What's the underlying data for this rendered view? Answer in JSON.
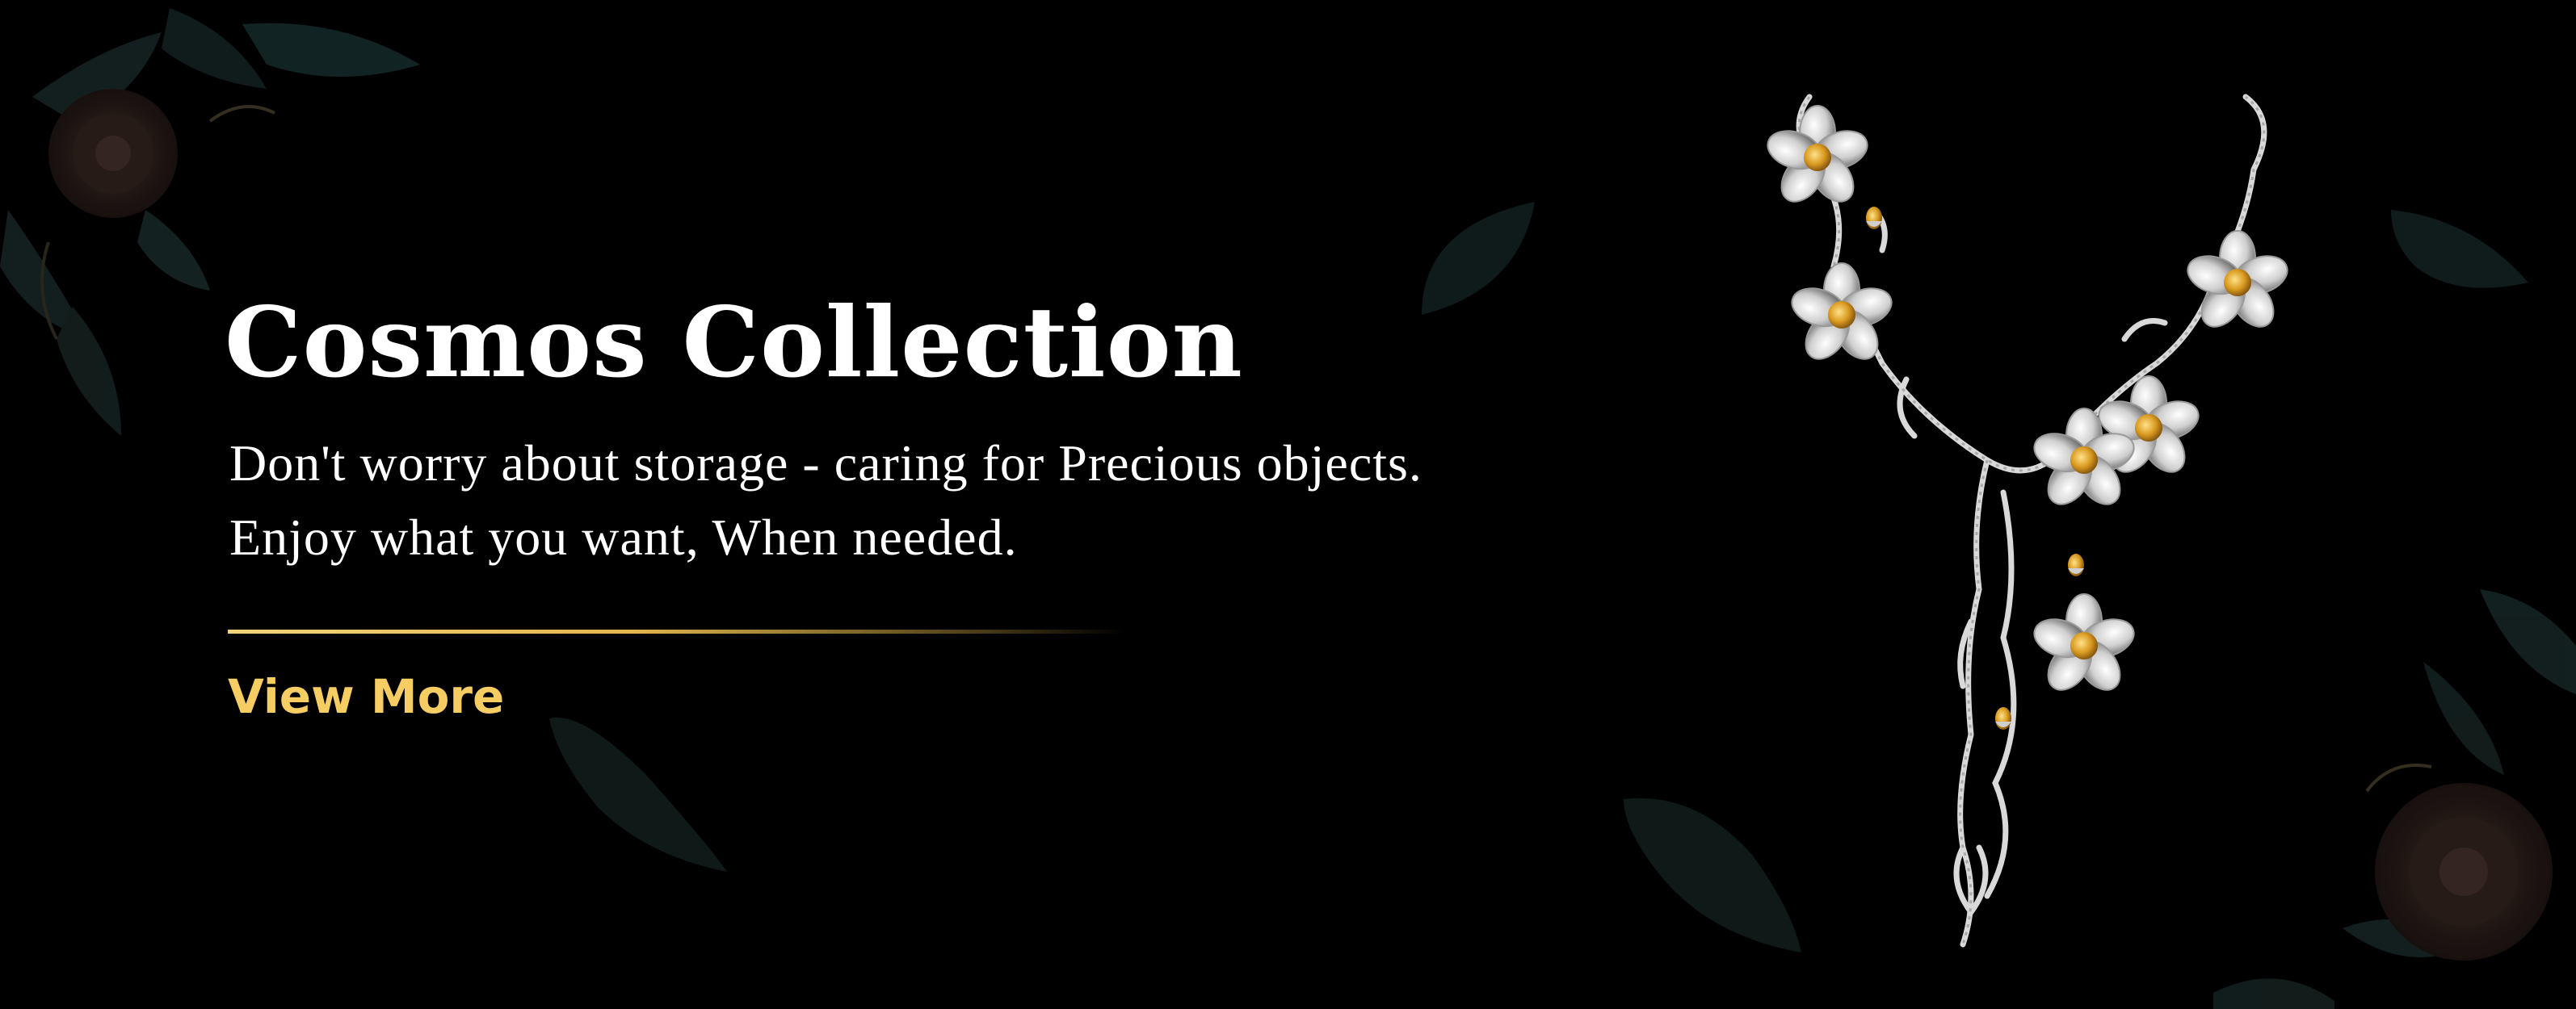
{
  "hero": {
    "title": "Cosmos Collection",
    "description_line1": "Don't worry about storage - caring for Precious objects.",
    "description_line2": "Enjoy what you want, When needed.",
    "cta_label": "View More"
  },
  "colors": {
    "background": "#000000",
    "accent_gold": "#f6cd62",
    "text": "#ffffff"
  },
  "icons": {
    "product_image": "necklace-icon",
    "decorations": [
      "flower-bouquet-icon",
      "leaf-icon"
    ]
  }
}
